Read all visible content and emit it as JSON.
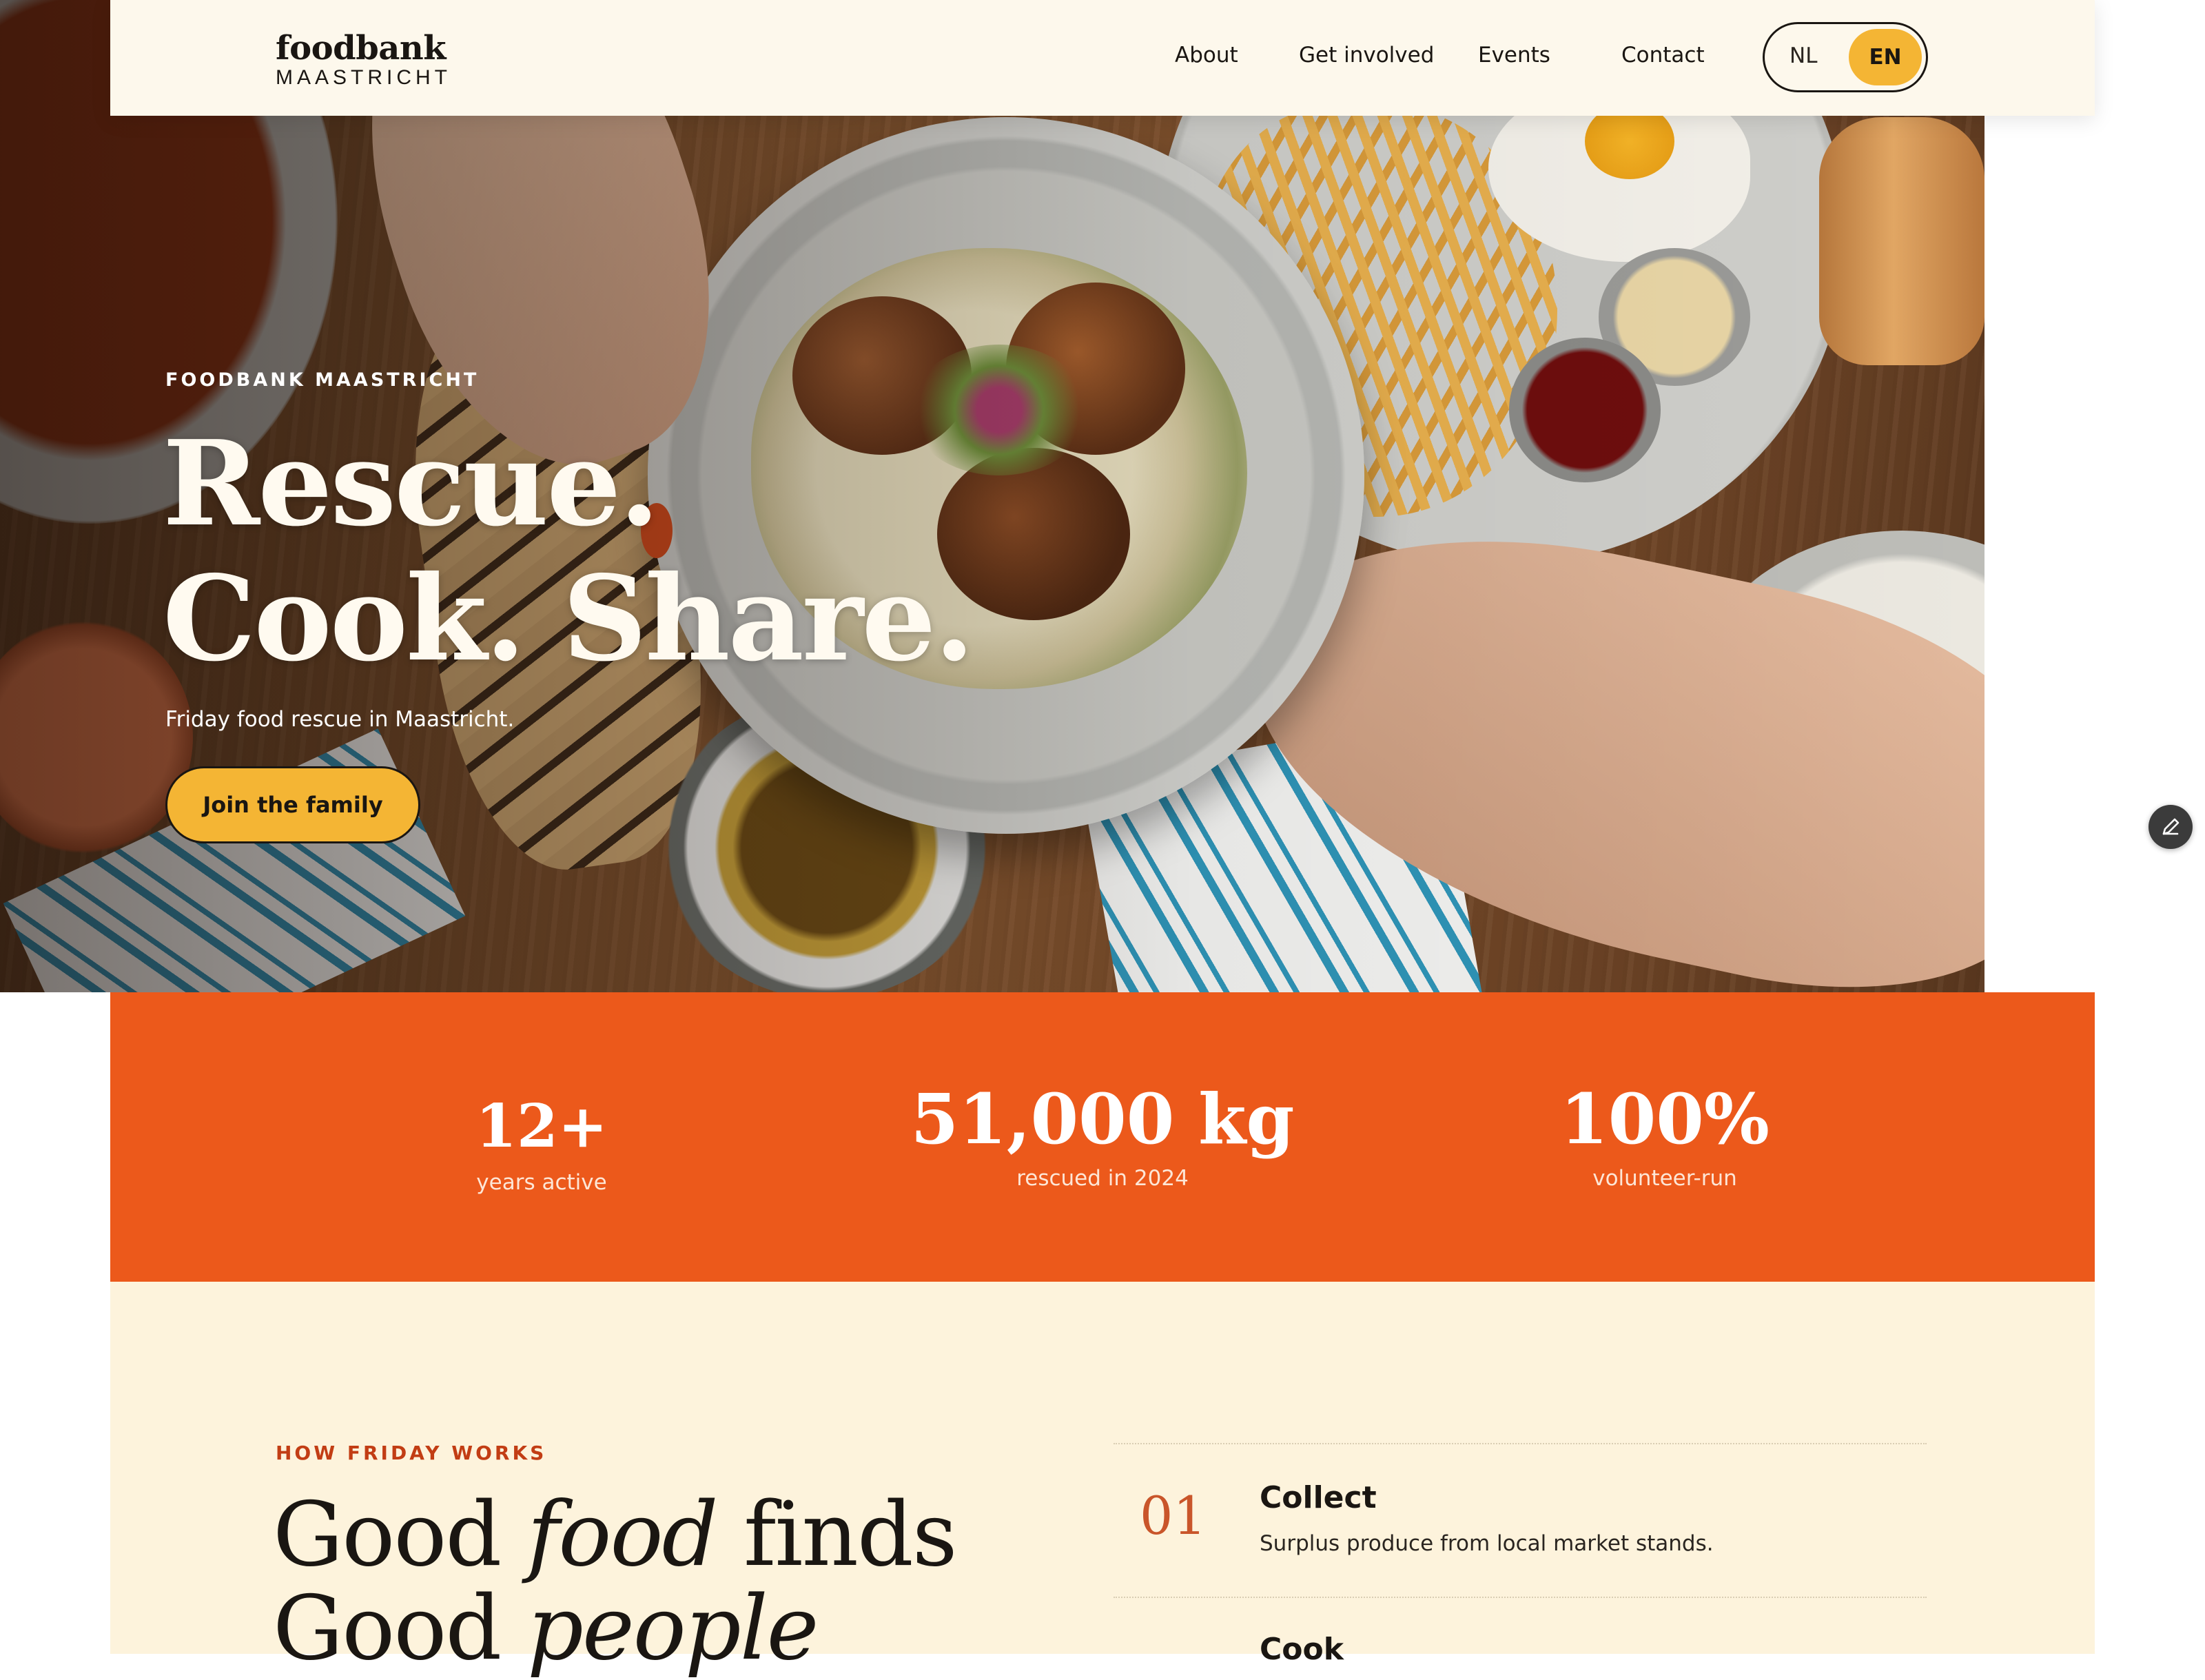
{
  "header": {
    "logo_main": "foodbank",
    "logo_sub": "MAASTRICHT",
    "nav": [
      "About",
      "Get involved",
      "Events",
      "Contact"
    ],
    "lang": {
      "nl": "NL",
      "en": "EN",
      "active": "EN"
    }
  },
  "hero": {
    "eyebrow": "FOODBANK MAASTRICHT",
    "headline_line1": "Rescue.",
    "headline_line2": "Cook. Share.",
    "subtitle": "Friday food rescue in Maastricht.",
    "cta": "Join the family"
  },
  "stats": [
    {
      "value": "12+",
      "label": "years active"
    },
    {
      "value": "51,000 kg",
      "label": "rescued in 2024"
    },
    {
      "value": "100%",
      "label": "volunteer-run"
    }
  ],
  "how": {
    "eyebrow": "HOW FRIDAY WORKS",
    "title_a1": "Good ",
    "title_a2": "food",
    "title_a3": " finds",
    "title_b1": "Good ",
    "title_b2": "people",
    "steps": [
      {
        "num": "01",
        "title": "Collect",
        "desc": "Surplus produce from local market stands."
      },
      {
        "title": "Cook"
      }
    ]
  },
  "colors": {
    "accent_orange": "#ec591b",
    "accent_yellow": "#f4b534",
    "cream": "#fdf3dc",
    "header_bg": "#fdf8ec",
    "ink": "#1a1612"
  },
  "icons": {
    "floating": "pencil-icon"
  }
}
